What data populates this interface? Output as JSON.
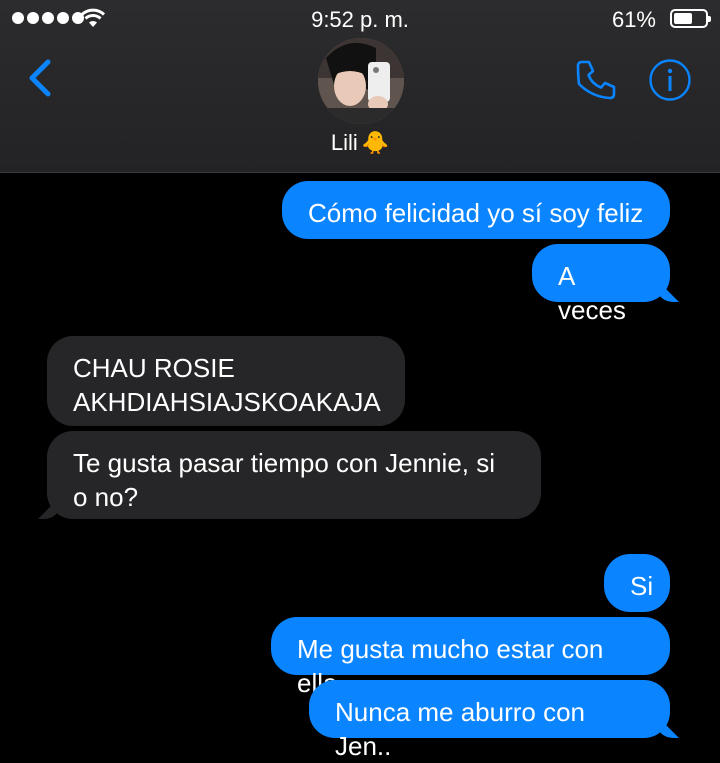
{
  "status_bar": {
    "time": "9:52 p. m.",
    "battery_percent": "61%",
    "battery_level": 0.61,
    "signal_dots": 5
  },
  "header": {
    "contact_name": "Lili",
    "contact_emoji": "🐥",
    "icons": [
      "back-chevron-icon",
      "phone-icon",
      "info-icon"
    ],
    "accent_color": "#0a84ff"
  },
  "messages": [
    {
      "direction": "out",
      "text": "Cómo felicidad yo sí soy feliz"
    },
    {
      "direction": "out",
      "text": "A veces"
    },
    {
      "direction": "in",
      "text": "CHAU ROSIE AKHDIAHSIAJSKOAKAJA"
    },
    {
      "direction": "in",
      "text": "Te gusta pasar tiempo con Jennie, si o no?"
    },
    {
      "direction": "out",
      "text": "Si"
    },
    {
      "direction": "out",
      "text": "Me gusta mucho estar con ella"
    },
    {
      "direction": "out",
      "text": "Nunca me aburro con Jen.."
    }
  ]
}
